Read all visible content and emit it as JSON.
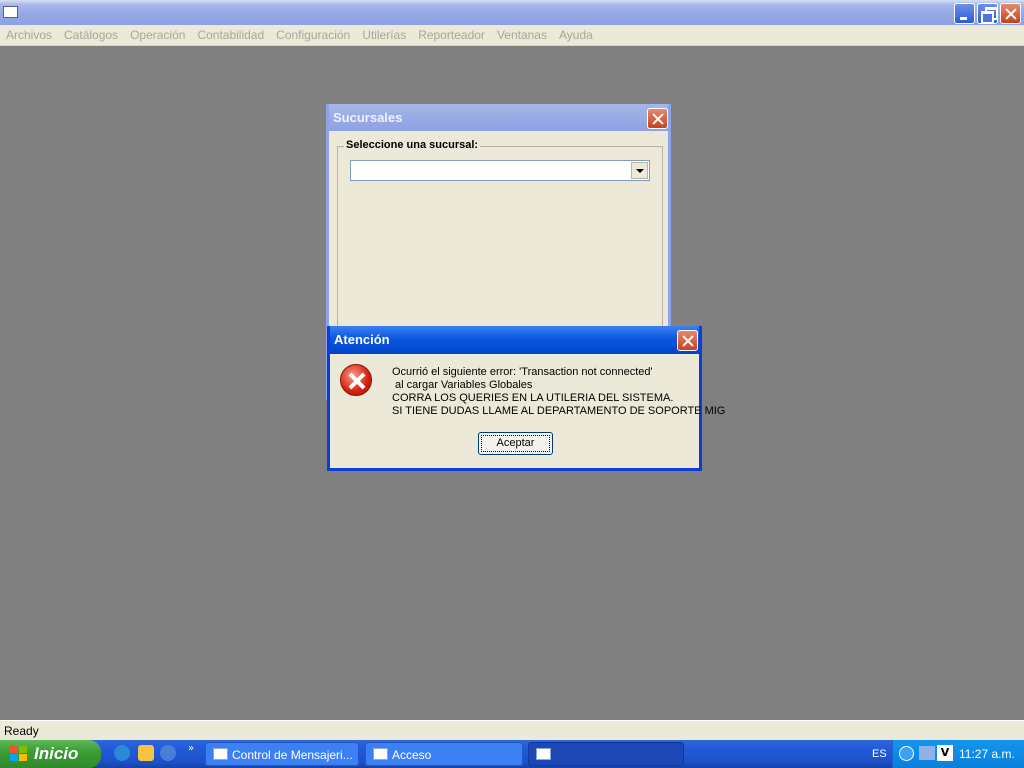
{
  "app": {
    "title": "",
    "menu": [
      "Archivos",
      "Catálogos",
      "Operación",
      "Contabilidad",
      "Configuración",
      "Utilerías",
      "Reporteador",
      "Ventanas",
      "Ayuda"
    ]
  },
  "sucursales_dialog": {
    "title": "Sucursales",
    "group_label": "Seleccione una sucursal:",
    "combo_value": ""
  },
  "error_dialog": {
    "title": "Atención",
    "message": "Ocurrió el siguiente error: 'Transaction not connected'\n al cargar Variables Globales\nCORRA LOS QUERIES EN LA UTILERIA DEL SISTEMA.\nSI TIENE DUDAS LLAME AL DEPARTAMENTO DE SOPORTE MIG",
    "ok_label": "Aceptar"
  },
  "statusbar": {
    "text": "Ready"
  },
  "taskbar": {
    "start_label": "Inicio",
    "tasks": [
      "Control de Mensajeri...",
      "Acceso",
      ""
    ],
    "language": "ES",
    "clock": "11:27 a.m."
  },
  "icons": {
    "error": "error-x-icon",
    "start_logo": "windows-logo-icon"
  }
}
